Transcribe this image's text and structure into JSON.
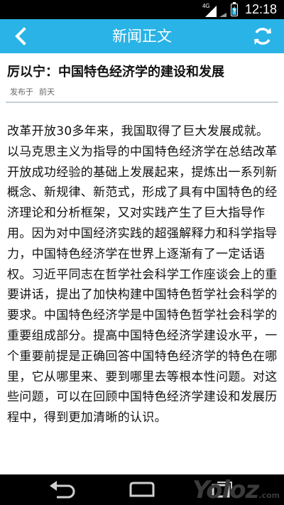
{
  "status_bar": {
    "network": "4G",
    "time": "12:18",
    "colors": {
      "background": "#000000",
      "battery_accent": "#2fb7e6"
    }
  },
  "app_bar": {
    "title": "新闻正文",
    "back_icon": "chevron-left-icon",
    "refresh_icon": "refresh-icon",
    "color": "#29b3e6"
  },
  "article": {
    "headline": "厉以宁：中国特色经济学的建设和发展",
    "meta_label": "发布于",
    "meta_value": "前天",
    "body": "改革开放30多年来，我国取得了巨大发展成就。以马克思主义为指导的中国特色经济学在总结改革开放成功经验的基础上发展起来，提炼出一系列新概念、新规律、新范式，形成了具有中国特色的经济理论和分析框架，又对实践产生了巨大指导作用。因为对中国经济实践的超强解释力和科学指导力，中国特色经济学在世界上逐渐有了一定话语权。习近平同志在哲学社会科学工作座谈会上的重要讲话，提出了加快构建中国特色哲学社会科学的要求。中国特色经济学是中国特色哲学社会科学的重要组成部分。提高中国特色经济学建设水平，一个重要前提是正确回答中国特色经济学的特色在哪里，它从哪里来、要到哪里去等根本性问题。对这些问题，可以在回顾中国特色经济学建设和发展历程中，得到更加清晰的认识。"
  },
  "nav_bar": {
    "icons": [
      "back-icon",
      "home-icon",
      "recent-apps-icon"
    ],
    "watermark": "Yoloz",
    "watermark_suffix": ".com"
  }
}
